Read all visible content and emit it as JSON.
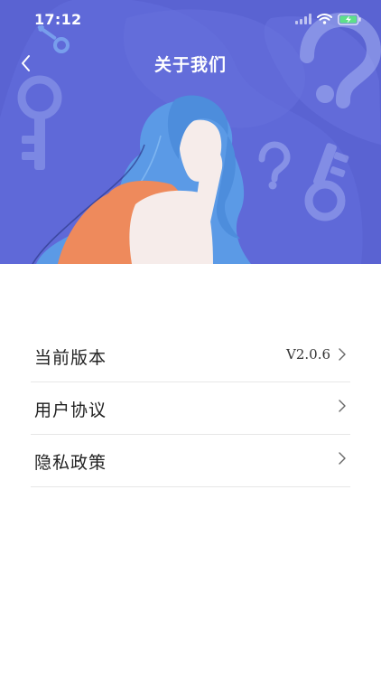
{
  "status_bar": {
    "time": "17:12",
    "icons": [
      "signal-icon",
      "wifi-icon",
      "battery-charging-icon"
    ]
  },
  "header": {
    "title": "关于我们",
    "back_icon": "chevron-left-icon"
  },
  "hero": {
    "background_color": "#5a63d2",
    "illustration": "woman-thinking-with-keys-and-question-marks"
  },
  "menu": {
    "items": [
      {
        "label": "当前版本",
        "value": "V2.0.6",
        "icon": "chevron-right-icon"
      },
      {
        "label": "用户协议",
        "value": "",
        "icon": "chevron-right-icon"
      },
      {
        "label": "隐私政策",
        "value": "",
        "icon": "chevron-right-icon"
      }
    ]
  },
  "colors": {
    "accent": "#5a63d2",
    "hair": "#5b9ae6",
    "dress": "#ee8a5c",
    "skin": "#f6ecea",
    "divider": "#e7e7e7"
  }
}
